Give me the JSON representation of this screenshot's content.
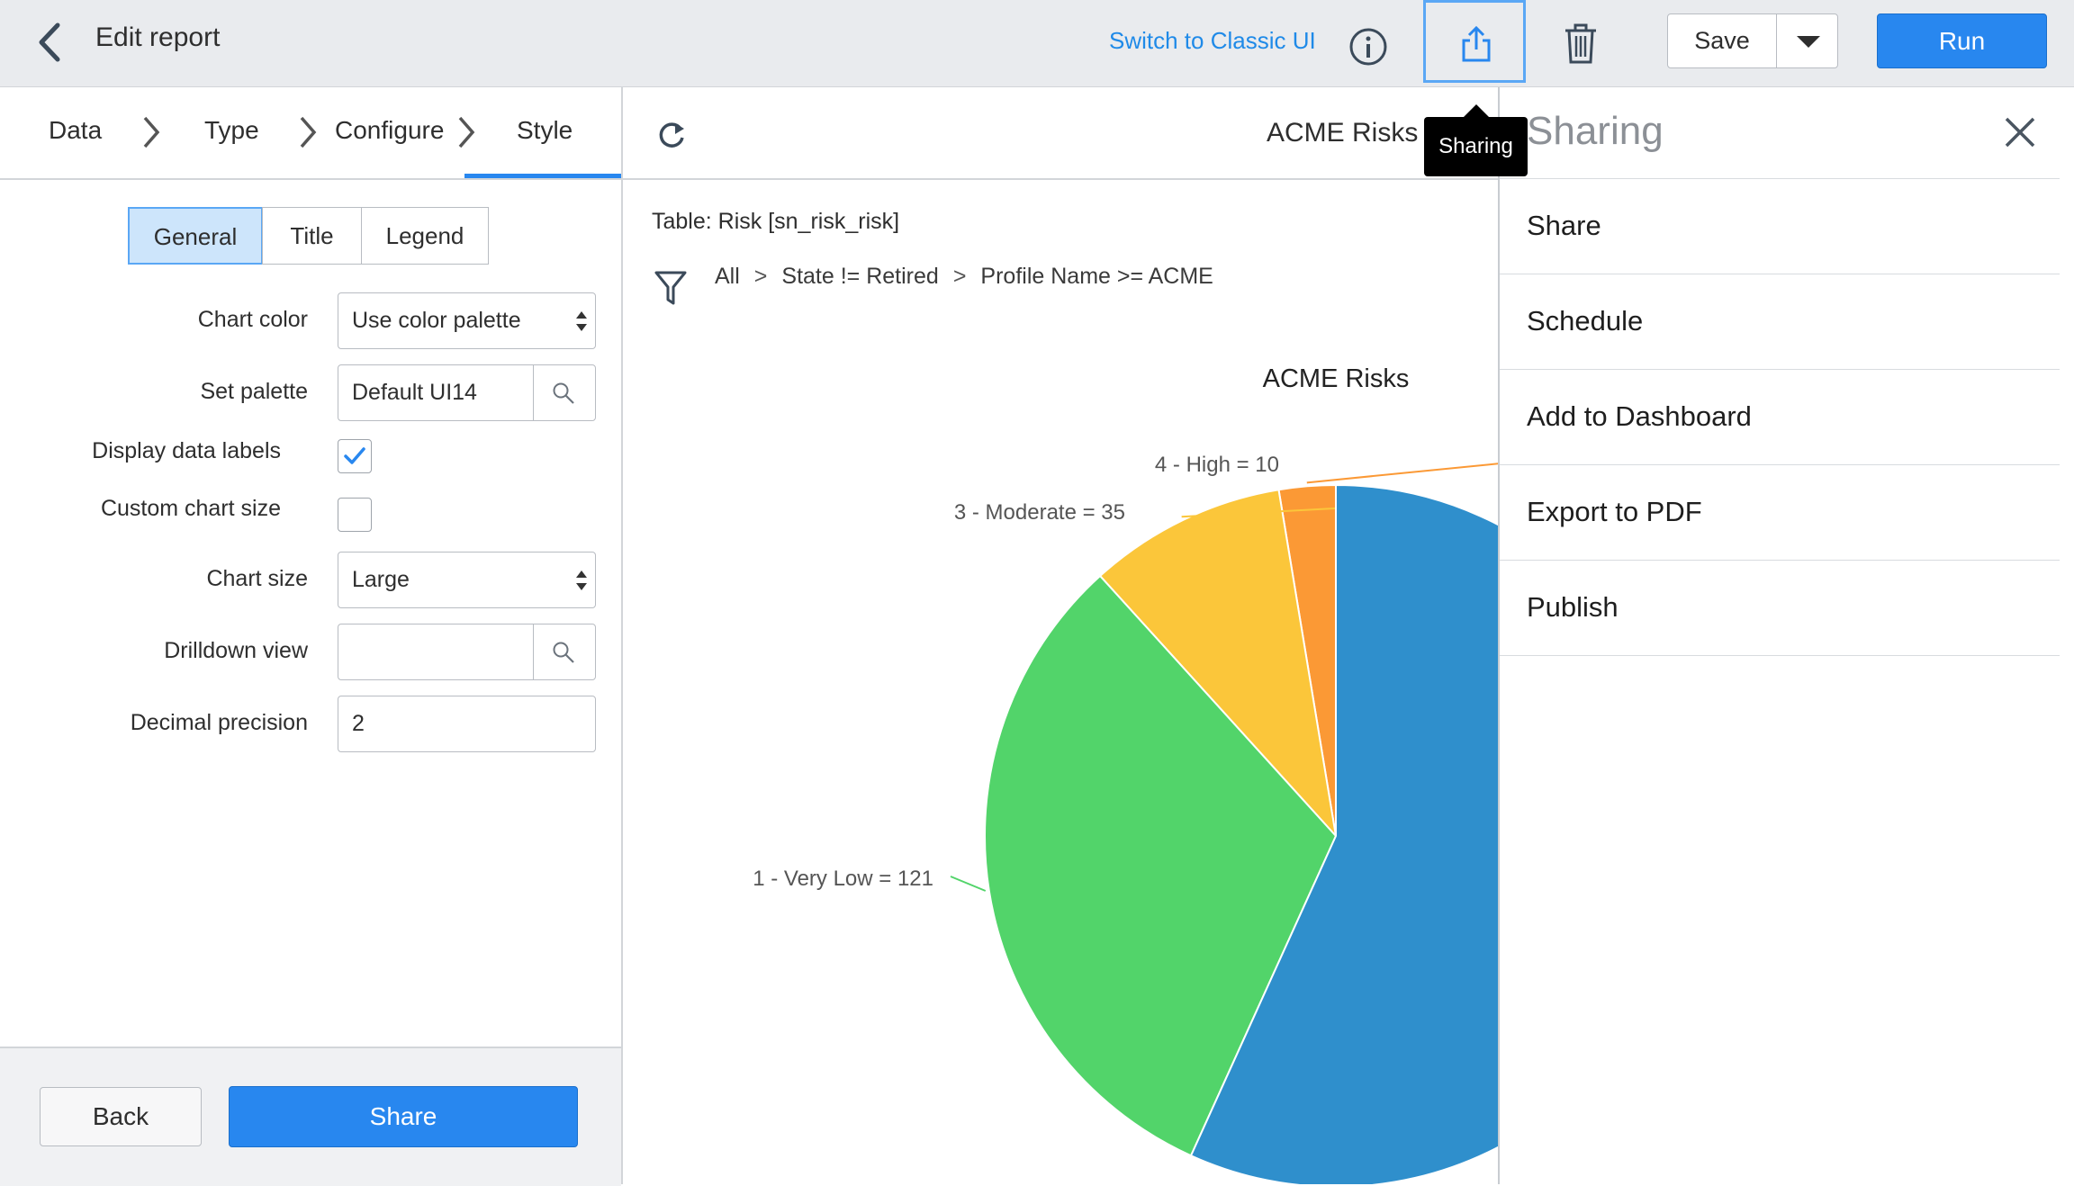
{
  "header": {
    "title": "Edit report",
    "switch_link": "Switch to Classic UI",
    "save_label": "Save",
    "run_label": "Run",
    "tooltip": "Sharing"
  },
  "steps": [
    "Data",
    "Type",
    "Configure",
    "Style"
  ],
  "style_tabs": [
    "General",
    "Title",
    "Legend"
  ],
  "form": {
    "chart_color_label": "Chart color",
    "chart_color_value": "Use color palette",
    "set_palette_label": "Set palette",
    "set_palette_value": "Default UI14",
    "display_labels_label": "Display data labels",
    "display_labels_checked": true,
    "custom_size_label": "Custom chart size",
    "custom_size_checked": false,
    "chart_size_label": "Chart size",
    "chart_size_value": "Large",
    "drilldown_label": "Drilldown view",
    "drilldown_value": "",
    "decimal_label": "Decimal precision",
    "decimal_value": "2"
  },
  "footer": {
    "back_label": "Back",
    "share_label": "Share"
  },
  "report": {
    "name": "ACME Risks",
    "table_line": "Table: Risk [sn_risk_risk]",
    "filter": [
      "All",
      "State != Retired",
      "Profile Name >= ACME"
    ]
  },
  "sharing_panel": {
    "title": "Sharing",
    "items": [
      "Share",
      "Schedule",
      "Add to Dashboard",
      "Export to PDF",
      "Publish"
    ]
  },
  "chart_data": {
    "type": "pie",
    "title": "ACME Risks",
    "slices": [
      {
        "label": "4 - High",
        "value": 10,
        "color": "#fb9935"
      },
      {
        "label": "3 - Moderate",
        "value": 35,
        "color": "#fbc63a"
      },
      {
        "label": "1 - Very Low",
        "value": 121,
        "color": "#52d46a"
      },
      {
        "label": "",
        "value": 218,
        "color": "#2f8fcc"
      }
    ],
    "data_labels": [
      "4 - High = 10",
      "3 - Moderate = 35",
      "1 - Very Low = 121"
    ]
  },
  "colors": {
    "accent": "#2887ef",
    "topbar": "#e9ebee"
  }
}
